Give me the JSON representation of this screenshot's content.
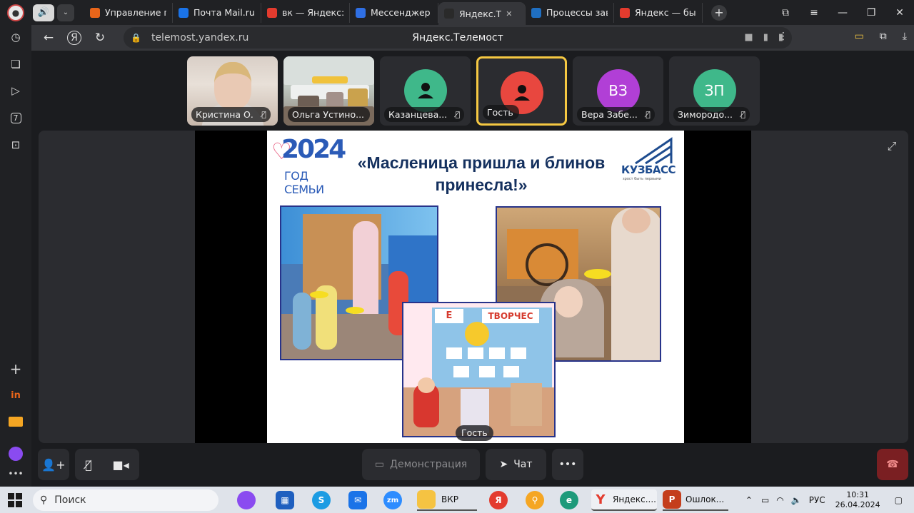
{
  "browser": {
    "tabs": [
      {
        "label": "Управление пр",
        "icon": "in-icon",
        "color": "#e8651a"
      },
      {
        "label": "Почта Mail.ru",
        "icon": "mail-icon",
        "color": "#1a73e8"
      },
      {
        "label": "вк — Яндекс: н",
        "icon": "yandex-icon",
        "color": "#e33b2e"
      },
      {
        "label": "Мессенджер",
        "icon": "messenger-icon",
        "color": "#2f6fe4"
      },
      {
        "label": "Яндекс.Т",
        "icon": "telemost-icon",
        "color": "#2a2a2a",
        "close": "✕"
      },
      {
        "label": "Процессы заве",
        "icon": "s-icon",
        "color": "#1f6fc2"
      },
      {
        "label": "Яндекс — быст",
        "icon": "yandex-icon",
        "color": "#e33b2e"
      }
    ],
    "url": "telemost.yandex.ru",
    "page_title": "Яндекс.Телемост"
  },
  "participants": [
    {
      "name": "Кристина О.",
      "type": "photo",
      "muted": true
    },
    {
      "name": "Ольга Устино...",
      "type": "photo",
      "muted": false
    },
    {
      "name": "Казанцева...",
      "type": "avatar",
      "initials": "",
      "color": "#3fb88a",
      "muted": true
    },
    {
      "name": "Гость",
      "type": "avatar",
      "initials": "",
      "color": "#e8473f",
      "muted": false,
      "selected": true
    },
    {
      "name": "Вера Забе...",
      "type": "avatar",
      "initials": "ВЗ",
      "color": "#b13fd6",
      "muted": true
    },
    {
      "name": "Зимородо...",
      "type": "avatar",
      "initials": "ЗП",
      "color": "#3fb88a",
      "muted": true
    }
  ],
  "slide": {
    "logo_year": "2024",
    "logo_sub": "ГОД СЕМЬИ",
    "title_line1": "«Масленица пришла и блинов",
    "title_line2": "принесла!»",
    "region_logo": "КУЗБАСС",
    "region_tagline": "зрост быть первыми",
    "board_text_left": "Е",
    "board_text_right": "ТВОРЧЕС"
  },
  "stage": {
    "speaker_label": "Гость"
  },
  "controls": {
    "demo_label": "Демонстрация",
    "chat_label": "Чат",
    "more_label": "•••"
  },
  "taskbar": {
    "search_placeholder": "Поиск",
    "items": [
      {
        "label": "ВКР"
      },
      {
        "label": "Яндекс...."
      },
      {
        "label": "Ошлок..."
      }
    ],
    "lang": "РУС",
    "time": "10:31",
    "date": "26.04.2024"
  }
}
